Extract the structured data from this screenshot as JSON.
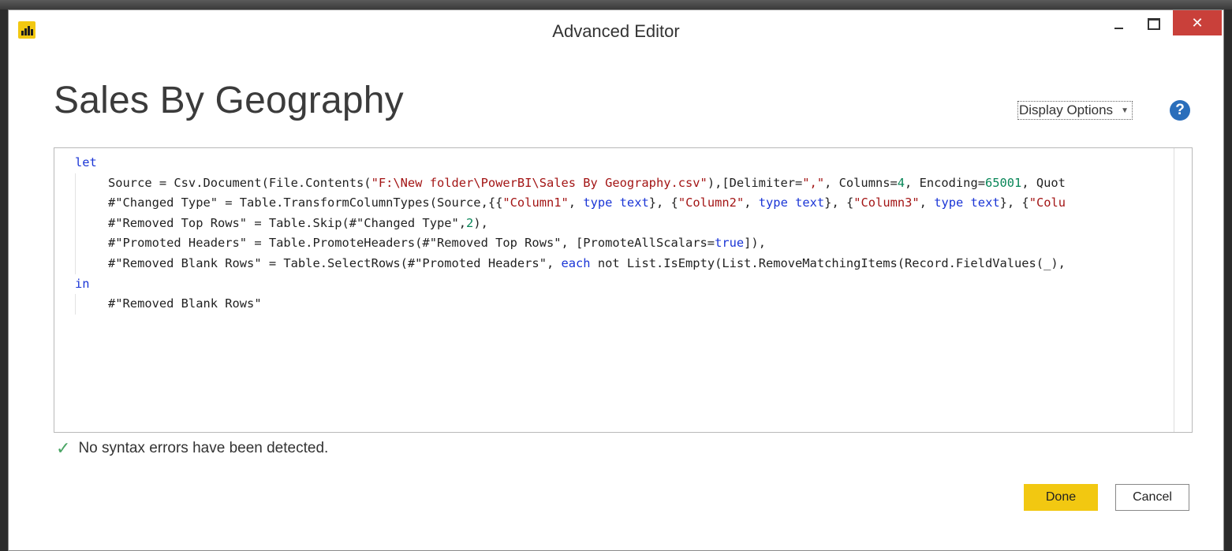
{
  "window": {
    "title": "Advanced Editor",
    "accent_color": "#f2c811",
    "close_color": "#c9403a"
  },
  "query_name": "Sales By Geography",
  "display_options": {
    "label": "Display Options"
  },
  "help": {
    "glyph": "?"
  },
  "code": {
    "lines": [
      {
        "indent": 0,
        "tokens": [
          {
            "t": "let",
            "c": "kw"
          }
        ]
      },
      {
        "indent": 1,
        "tokens": [
          {
            "t": "Source = Csv.Document(File.Contents("
          },
          {
            "t": "\"F:\\New folder\\PowerBI\\Sales By Geography.csv\"",
            "c": "str"
          },
          {
            "t": "),[Delimiter="
          },
          {
            "t": "\",\"",
            "c": "str"
          },
          {
            "t": ", Columns="
          },
          {
            "t": "4",
            "c": "num"
          },
          {
            "t": ", Encoding="
          },
          {
            "t": "65001",
            "c": "num"
          },
          {
            "t": ", Quot"
          }
        ]
      },
      {
        "indent": 1,
        "tokens": [
          {
            "t": "#\"Changed Type\" = Table.TransformColumnTypes(Source,{{"
          },
          {
            "t": "\"Column1\"",
            "c": "str"
          },
          {
            "t": ", "
          },
          {
            "t": "type text",
            "c": "kw"
          },
          {
            "t": "}, {"
          },
          {
            "t": "\"Column2\"",
            "c": "str"
          },
          {
            "t": ", "
          },
          {
            "t": "type text",
            "c": "kw"
          },
          {
            "t": "}, {"
          },
          {
            "t": "\"Column3\"",
            "c": "str"
          },
          {
            "t": ", "
          },
          {
            "t": "type text",
            "c": "kw"
          },
          {
            "t": "}, {"
          },
          {
            "t": "\"Colu",
            "c": "str"
          }
        ]
      },
      {
        "indent": 1,
        "tokens": [
          {
            "t": "#\"Removed Top Rows\" = Table.Skip(#\"Changed Type\","
          },
          {
            "t": "2",
            "c": "num"
          },
          {
            "t": "),"
          }
        ]
      },
      {
        "indent": 1,
        "tokens": [
          {
            "t": "#\"Promoted Headers\" = Table.PromoteHeaders(#\"Removed Top Rows\", [PromoteAllScalars="
          },
          {
            "t": "true",
            "c": "kw"
          },
          {
            "t": "]),"
          }
        ]
      },
      {
        "indent": 1,
        "tokens": [
          {
            "t": "#\"Removed Blank Rows\" = Table.SelectRows(#\"Promoted Headers\", "
          },
          {
            "t": "each",
            "c": "kw"
          },
          {
            "t": " not List.IsEmpty(List.RemoveMatchingItems(Record.FieldValues(_),"
          }
        ]
      },
      {
        "indent": 0,
        "tokens": [
          {
            "t": "in",
            "c": "kw"
          }
        ]
      },
      {
        "indent": 1,
        "tokens": [
          {
            "t": "#\"Removed Blank Rows\""
          }
        ]
      }
    ]
  },
  "status": {
    "message": "No syntax errors have been detected."
  },
  "buttons": {
    "done": "Done",
    "cancel": "Cancel"
  }
}
